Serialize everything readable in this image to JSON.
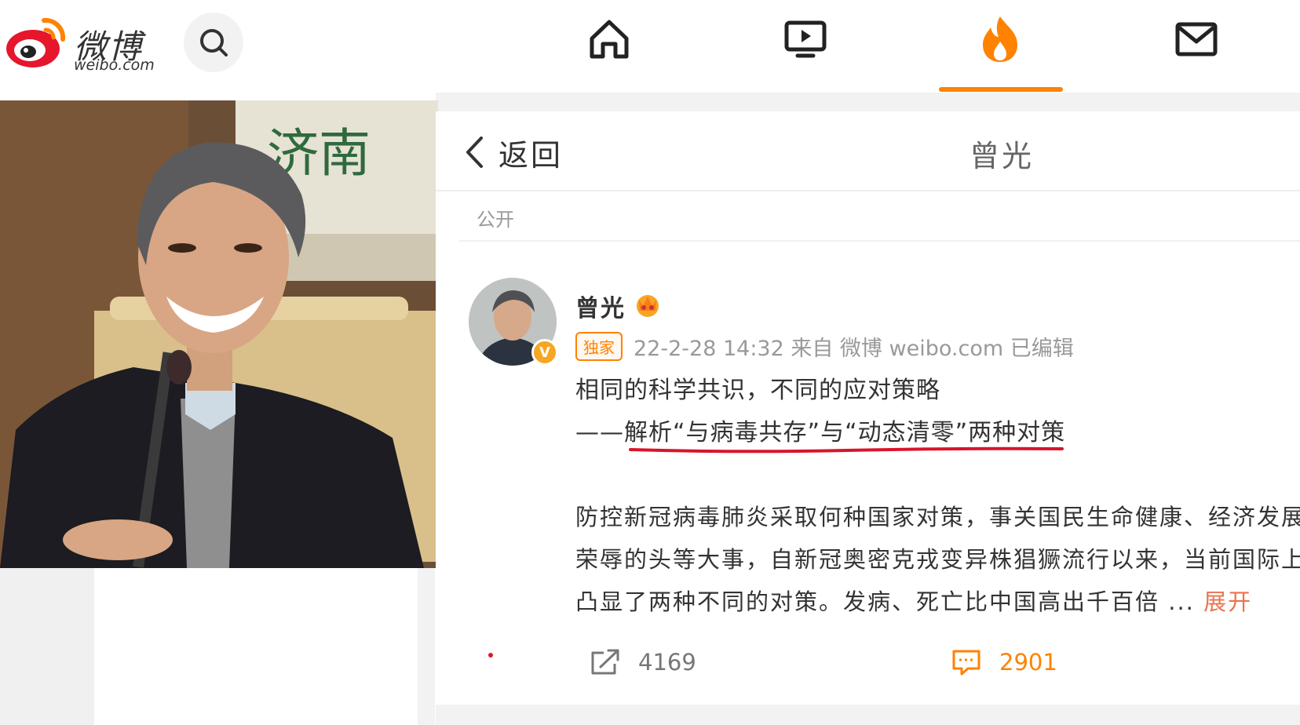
{
  "header": {
    "logo_cn": "微博",
    "logo_en": "weibo.com",
    "brand_color": "#ff8200",
    "nav_icons": [
      "home-icon",
      "video-icon",
      "hot-icon",
      "mail-icon"
    ],
    "active_nav": "hot-icon"
  },
  "detail": {
    "back_label": "返回",
    "page_title": "曾光",
    "visibility": "公开"
  },
  "post": {
    "author": "曾光",
    "tag": "独家",
    "meta": "22-2-28 14:32 来自 微博 weibo.com 已编辑",
    "title_line1": "相同的科学共识，不同的应对策略",
    "title_line2": "——解析“与病毒共存”与“动态清零”两种对策",
    "body_line1": "防控新冠病毒肺炎采取何种国家对策，事关国民生命健康、经济发展",
    "body_line2": "荣辱的头等大事，自新冠奥密克戎变异株猖獗流行以来，当前国际上",
    "body_line3": "凸显了两种不同的对策。发病、死亡比中国高出千百倍 ...",
    "expand_label": "展开",
    "repost_count": "4169",
    "comment_count": "2901"
  }
}
